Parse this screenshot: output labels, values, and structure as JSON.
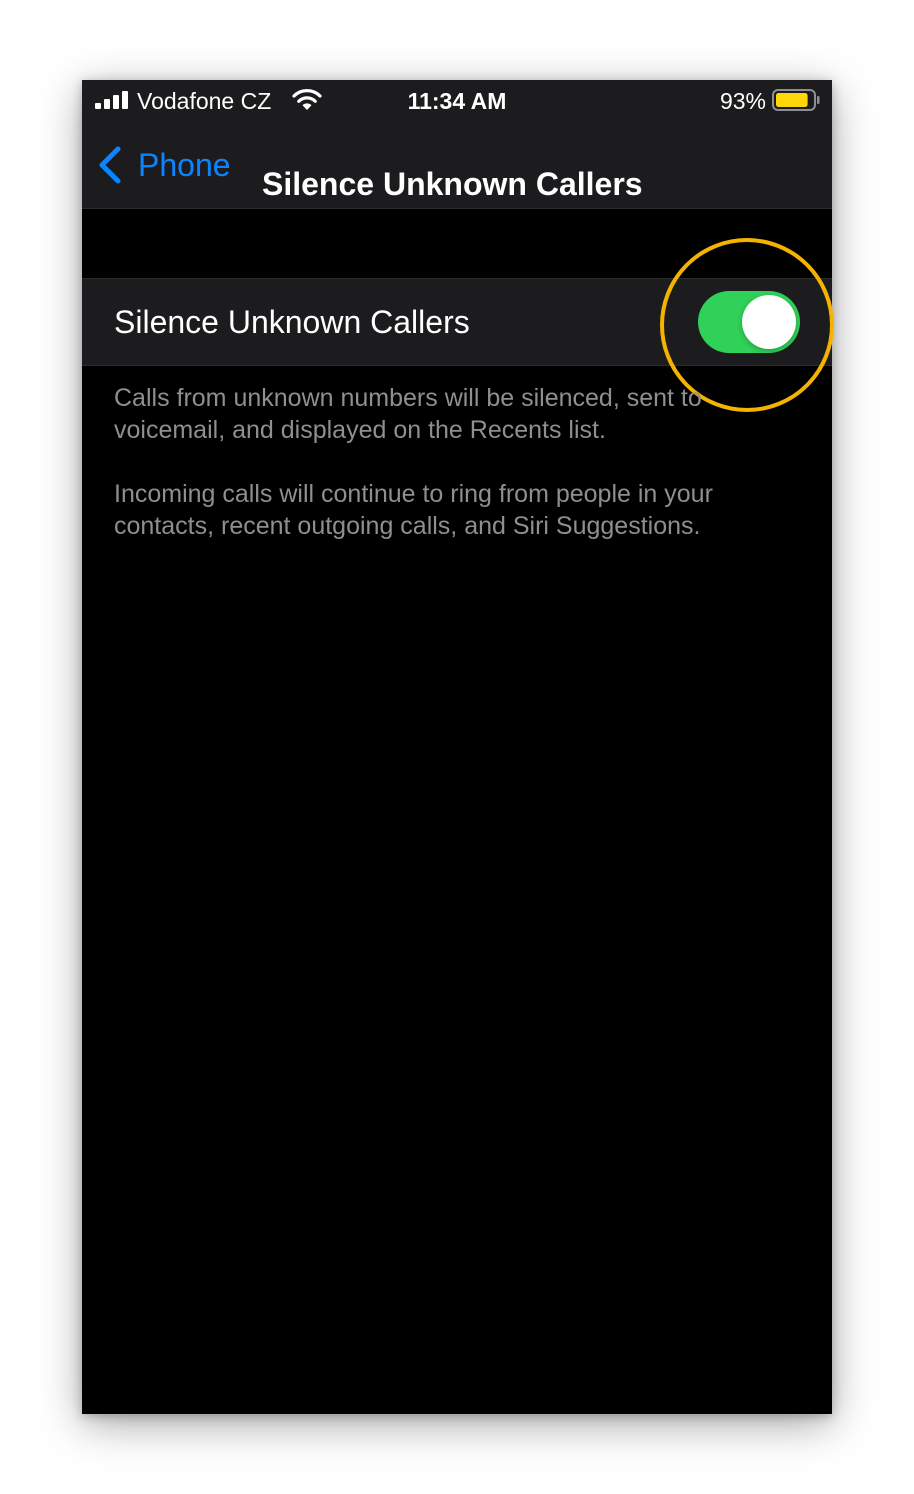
{
  "status_bar": {
    "carrier": "Vodafone CZ",
    "time": "11:34 AM",
    "battery_percent": "93%",
    "battery_level": 0.93,
    "battery_color": "#ffd60a",
    "signal_icon": "cellular-signal-icon",
    "wifi_icon": "wifi-icon",
    "battery_icon": "battery-icon"
  },
  "nav": {
    "back_label": "Phone",
    "back_icon": "chevron-left-icon",
    "title": "Silence Unknown Callers",
    "accent_color": "#0a84ff"
  },
  "setting": {
    "label": "Silence Unknown Callers",
    "enabled": true,
    "toggle_on_color": "#30d158",
    "highlight_color": "#f5b301"
  },
  "footer": {
    "line1": "Calls from unknown numbers will be silenced, sent to voicemail, and displayed on the Recents list.",
    "line2": "Incoming calls will continue to ring from people in your contacts, recent outgoing calls, and Siri Suggestions."
  }
}
